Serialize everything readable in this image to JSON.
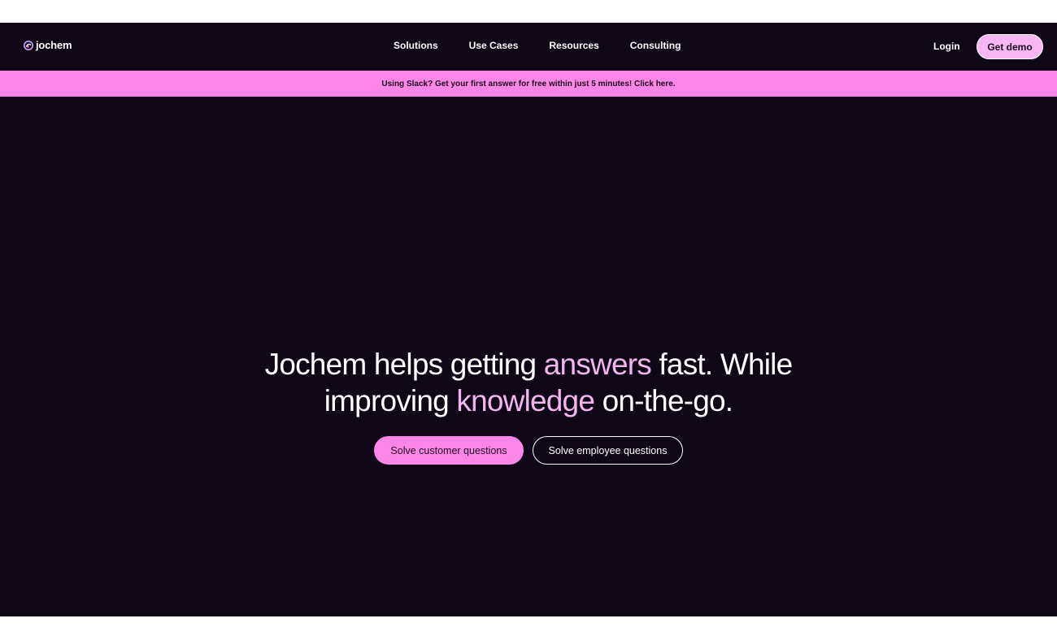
{
  "header": {
    "logo_text": "jochem",
    "nav": [
      {
        "label": "Solutions"
      },
      {
        "label": "Use Cases"
      },
      {
        "label": "Resources"
      },
      {
        "label": "Consulting"
      }
    ],
    "login_label": "Login",
    "demo_label": "Get demo"
  },
  "banner": {
    "text": "Using Slack? Get your first answer for free within just 5 minutes! Click here."
  },
  "hero": {
    "headline_parts": {
      "p1": "Jochem helps getting ",
      "accent1": "answers",
      "p2": " fast. While",
      "p3": "improving ",
      "accent2": "knowledge",
      "p4": " on-the-go."
    },
    "primary_cta": "Solve customer questions",
    "secondary_cta": "Solve employee questions"
  },
  "colors": {
    "background": "#0f0616",
    "accent_pink": "#fd86e8",
    "accent_light": "#f3b5ef",
    "text": "#ffffff"
  }
}
